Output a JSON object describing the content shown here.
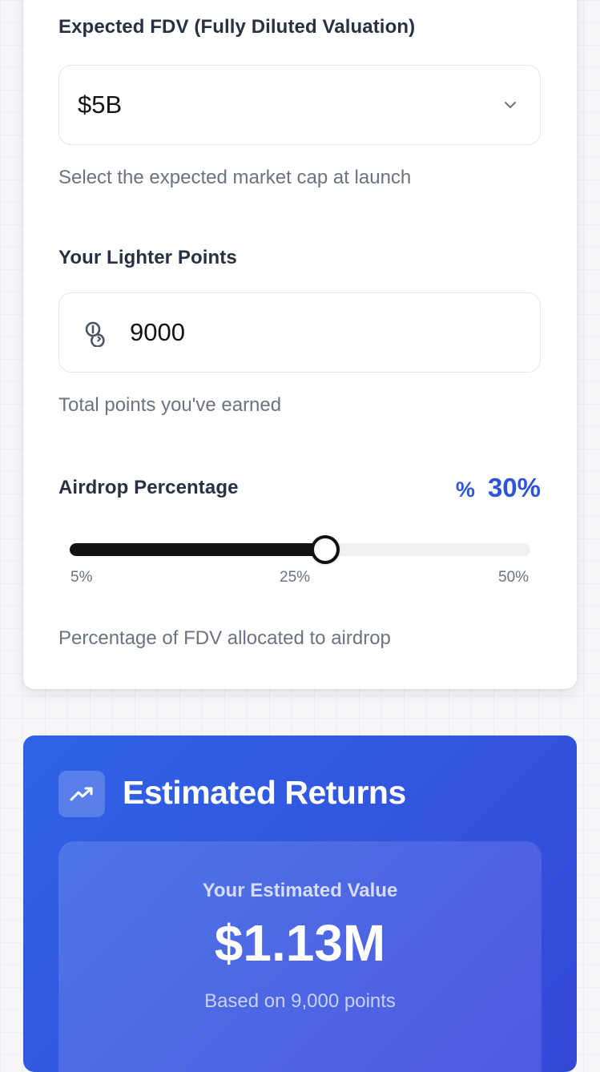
{
  "settings": {
    "fdv": {
      "label": "Expected FDV (Fully Diluted Valuation)",
      "selected": "$5B",
      "helper": "Select the expected market cap at launch",
      "icon": "chevron-down-icon"
    },
    "points": {
      "label": "Your Lighter Points",
      "value": "9000",
      "helper": "Total points you've earned",
      "icon": "coins-icon"
    },
    "airdrop": {
      "label": "Airdrop Percentage",
      "symbol": "%",
      "value_text": "30%",
      "value": 30,
      "min": 5,
      "max": 50,
      "ticks": [
        "5%",
        "25%",
        "50%"
      ],
      "helper": "Percentage of FDV allocated to airdrop"
    }
  },
  "returns": {
    "title": "Estimated Returns",
    "icon": "trending-up-icon",
    "value_label": "Your Estimated Value",
    "amount": "$1.13M",
    "basis": "Based on 9,000 points"
  },
  "colors": {
    "accent": "#2f54d6",
    "card_gradient_start": "#2f63e6",
    "card_gradient_end": "#3448d8"
  }
}
